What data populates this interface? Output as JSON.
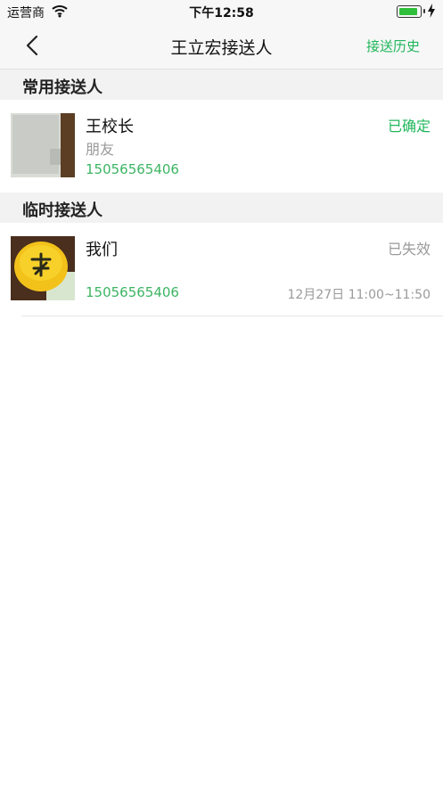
{
  "status_bar": {
    "carrier": "运营商",
    "time": "下午12:58",
    "battery_level": 0.9
  },
  "nav": {
    "title": "王立宏接送人",
    "action_label": "接送历史"
  },
  "sections": [
    {
      "title": "常用接送人",
      "items": [
        {
          "name": "王校长",
          "relation": "朋友",
          "phone": "15056565406",
          "status": "已确定",
          "status_color": "#1fb65a"
        }
      ]
    },
    {
      "title": "临时接送人",
      "items": [
        {
          "name": "我们",
          "phone": "15056565406",
          "status": "已失效",
          "time_range": "12月27日 11:00~11:50",
          "status_color": "#9a9a9a"
        }
      ]
    }
  ],
  "colors": {
    "accent": "#1fb65a",
    "phone": "#3cb563",
    "muted": "#9a9a9a",
    "section_bg": "#f2f2f2"
  }
}
